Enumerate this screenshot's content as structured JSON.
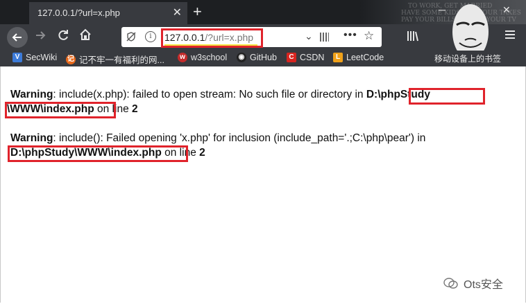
{
  "browser": {
    "tab_title": "127.0.0.1/?url=x.php",
    "tab_close": "✕",
    "new_tab": "+",
    "window_controls": {
      "minimize": "─",
      "maximize": "☐",
      "close": "✕"
    },
    "art_lines": [
      "TO WORK, GET MARRIED",
      "HAVE SOME KIDS, PAY YOUR TAXES",
      "PAY YOUR BILLS, WATCH YOUR TV",
      "FOLLOW FASHION, ACT NORMAL",
      "OBEY THE LAW",
      "AND REPEAT AFTER ME",
      "I AM FREE"
    ]
  },
  "nav": {
    "back_icon": "arrow-left-icon",
    "forward_icon": "arrow-right-icon",
    "reload_icon": "reload-icon",
    "home_icon": "home-icon",
    "url_host": "127.0.0.1",
    "url_path": "/?url=x.php",
    "dots": "•••",
    "star": "☆"
  },
  "bookmarks": [
    {
      "label": "SecWiki",
      "color": "#3d7bd8",
      "icon": "V"
    },
    {
      "label": "记不牢一有福利的网...",
      "color": "#e8681a",
      "icon": "记"
    },
    {
      "label": "w3school",
      "color": "#c52b2b",
      "icon": "w"
    },
    {
      "label": "GitHub",
      "color": "#222222",
      "icon": "◉"
    },
    {
      "label": "CSDN",
      "color": "#d8241f",
      "icon": "C"
    },
    {
      "label": "LeetCode",
      "color": "#f0a11a",
      "icon": "L"
    }
  ],
  "bookmarks_more": "移动设备上的书签",
  "page": {
    "w1_label": "Warning",
    "w1_text": ": include(x.php): failed to open stream: No such file or directory in ",
    "w1_path_a": "D:\\phpStudy",
    "w1_path_b": "\\WWW\\index.php",
    "w1_online": " on line ",
    "w1_line": "2",
    "w2_label": "Warning",
    "w2_text": ": include(): Failed opening 'x.php' for inclusion (include_path='.;C:\\php\\pear') in",
    "w2_path": "D:\\phpStudy\\WWW\\index.php",
    "w2_online": " on line ",
    "w2_line": "2"
  },
  "watermark": "Ots安全",
  "colors": {
    "highlight": "#e0232b",
    "url_underline": "#f5e642"
  }
}
